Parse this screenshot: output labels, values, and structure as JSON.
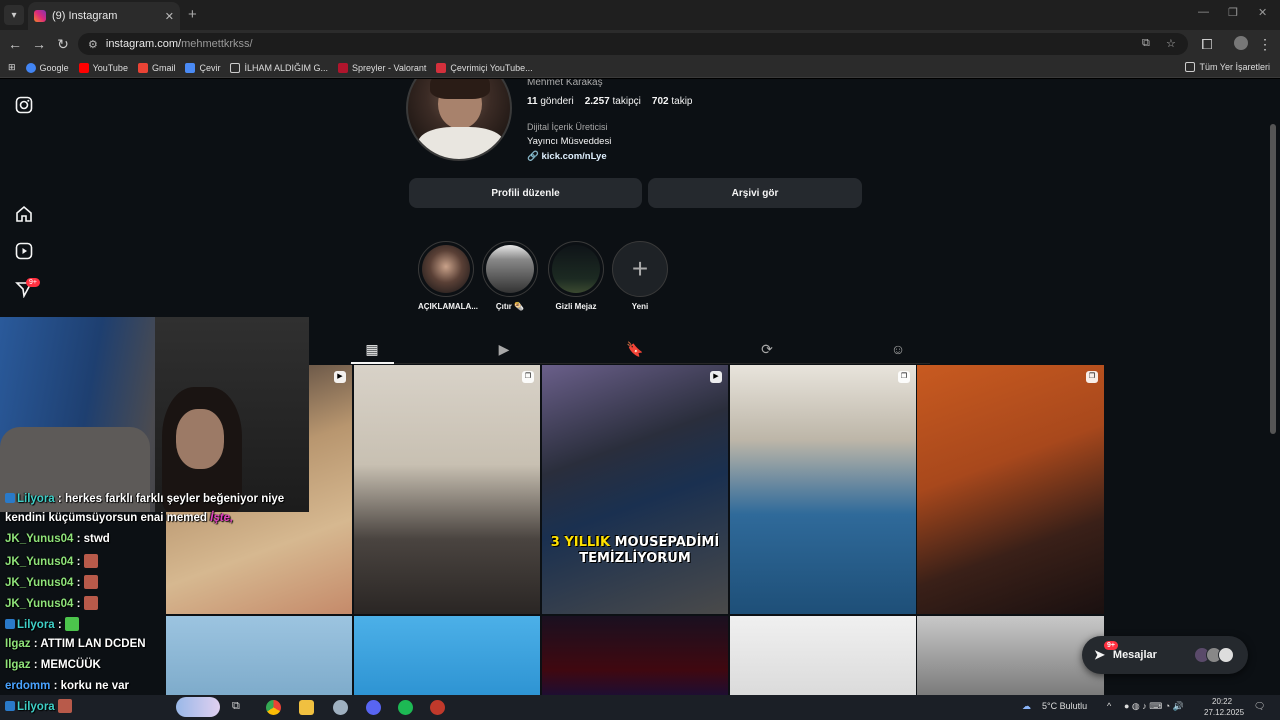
{
  "browser": {
    "tab_title": "(9) Instagram",
    "tab_close": "✕",
    "new_tab": "+",
    "url_host": "instagram.com/",
    "url_path": "mehmettkrkss/",
    "bookmarks": [
      "Google",
      "YouTube",
      "Gmail",
      "Çevir",
      "İLHAM ALDIĞIM G...",
      "Spreyler - Valorant",
      "Çevrimiçi YouTube..."
    ],
    "bookmarks_all": "Tüm Yer İşaretleri"
  },
  "profile": {
    "name": "Mehmet Karakaş",
    "posts_count": "11",
    "posts_label": "gönderi",
    "followers_count": "2.257",
    "followers_label": "takipçi",
    "following_count": "702",
    "following_label": "takip",
    "category": "Dijital İçerik Üreticisi",
    "bio": "Yayıncı Müsveddesi",
    "link": "kick.com/nLye",
    "edit_button": "Profili düzenle",
    "archive_button": "Arşivi gör"
  },
  "highlights": [
    {
      "label": "AÇIKLAMALA..."
    },
    {
      "label": "Çıtır 🌯"
    },
    {
      "label": "Gizli Mejaz"
    },
    {
      "label": "Yeni"
    }
  ],
  "notifications_badge": "9+",
  "post_caption": {
    "line1_a": "3 YILLIK",
    "line1_b": "MOUSEPADİMİ",
    "line2": "TEMİZLİYORUM"
  },
  "messages": {
    "label": "Mesajlar",
    "badge": "9+"
  },
  "chat": [
    {
      "user": "Lilyora",
      "text": ": herkes farklı farklı şeyler beğeniyor niye",
      "color": "u-teal"
    },
    {
      "user": "",
      "text": "kendini küçümsüyorsun enai memed",
      "color": "u-white"
    },
    {
      "user": "JK_Yunus04",
      "text": ": stwd",
      "color": "u-green"
    },
    {
      "user": "JK_Yunus04",
      "text": ":",
      "color": "u-green"
    },
    {
      "user": "JK_Yunus04",
      "text": ":",
      "color": "u-green"
    },
    {
      "user": "JK_Yunus04",
      "text": ":",
      "color": "u-green"
    },
    {
      "user": "Lilyora",
      "text": ":",
      "color": "u-teal"
    },
    {
      "user": "Ilgaz",
      "text": ": ATTIM LAN DCDEN",
      "color": "u-green"
    },
    {
      "user": "Ilgaz",
      "text": ": MEMCÜÜK",
      "color": "u-green"
    },
    {
      "user": "erdomm",
      "text": ": korku ne var",
      "color": "u-blue"
    },
    {
      "user": "Lilyora",
      "text": "",
      "color": "u-teal"
    }
  ],
  "overlay_text": "İşte,",
  "taskbar": {
    "weather": "5°C Bulutlu",
    "time": "20:22",
    "date": "27.12.2025"
  },
  "colors": {
    "ig_bg": "#0c1014",
    "button_bg": "#25292e",
    "badge_red": "#ff3040"
  }
}
